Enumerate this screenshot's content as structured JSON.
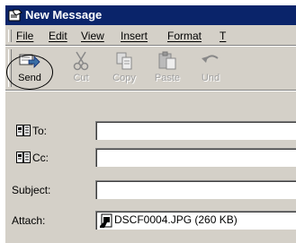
{
  "window": {
    "title": "New Message"
  },
  "menu": [
    "File",
    "Edit",
    "View",
    "Insert",
    "Format",
    "T"
  ],
  "toolbar": [
    {
      "label": "Send",
      "enabled": true,
      "icon": "send-icon"
    },
    {
      "label": "Cut",
      "enabled": false,
      "icon": "cut-icon"
    },
    {
      "label": "Copy",
      "enabled": false,
      "icon": "copy-icon"
    },
    {
      "label": "Paste",
      "enabled": false,
      "icon": "paste-icon"
    },
    {
      "label": "Und",
      "enabled": false,
      "icon": "undo-icon"
    }
  ],
  "headers": {
    "to": {
      "label": "To:",
      "value": ""
    },
    "cc": {
      "label": "Cc:",
      "value": ""
    },
    "subject": {
      "label": "Subject:",
      "value": ""
    },
    "attach": {
      "label": "Attach:",
      "file": "DSCF0004.JPG (260 KB)"
    }
  },
  "colors": {
    "titlebar": "#0a246a",
    "chrome": "#d4d0c8",
    "disabled_text": "#a0a0a0"
  }
}
